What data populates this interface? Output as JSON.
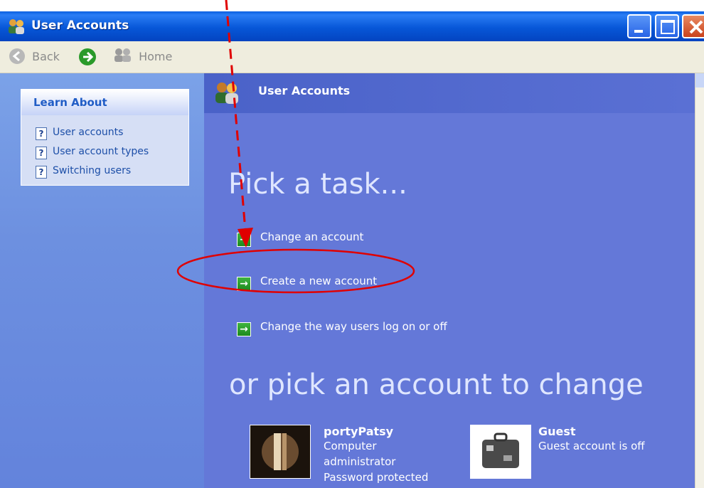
{
  "window": {
    "title": "User Accounts"
  },
  "toolbar": {
    "back_label": "Back",
    "home_label": "Home"
  },
  "learn_about": {
    "title": "Learn About",
    "links": [
      "User accounts",
      "User account types",
      "Switching users"
    ]
  },
  "main": {
    "header_title": "User Accounts",
    "pick_task": "Pick a task...",
    "tasks": [
      "Change an account",
      "Create a new account",
      "Change the way users log on or off"
    ],
    "pick_account": "or pick an account to change",
    "accounts": [
      {
        "name": "portyPatsy",
        "lines": [
          "Computer",
          "administrator",
          "Password protected"
        ]
      },
      {
        "name": "Guest",
        "lines": [
          "Guest account is off"
        ]
      }
    ]
  },
  "colors": {
    "title_bar": "#0757d8",
    "main_pane": "#6478d8",
    "annotation_red": "#e00000"
  },
  "icons": [
    "user-accounts-icon",
    "back-icon",
    "forward-icon",
    "home-icon",
    "help-icon",
    "green-arrow-icon",
    "minimize-icon",
    "maximize-icon",
    "close-icon"
  ]
}
